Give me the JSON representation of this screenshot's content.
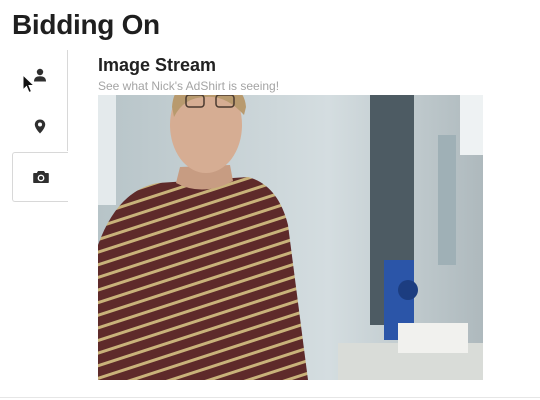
{
  "page": {
    "title": "Bidding On"
  },
  "sidebar": {
    "tabs": [
      {
        "icon": "user-icon",
        "active": false
      },
      {
        "icon": "map-marker-icon",
        "active": false
      },
      {
        "icon": "camera-icon",
        "active": true
      }
    ]
  },
  "stream": {
    "title": "Image Stream",
    "subtitle": "See what Nick's AdShirt is seeing!"
  },
  "colors": {
    "title": "#1f1f1f",
    "subtitle": "#a4a4a4",
    "icon": "#2f2f2f",
    "border": "#d8d8d8",
    "shirt_stripe": "#c9b27a",
    "shirt_base": "#5e2a2a"
  }
}
